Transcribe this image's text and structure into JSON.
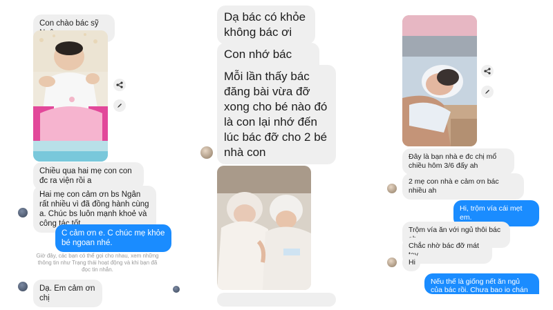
{
  "left": {
    "messages": [
      "Con chào bác sỹ Ngân",
      "Chiều qua hai mẹ con con đc ra viện rồi a",
      "Hai mẹ con cảm ơn bs Ngân rất nhiều vì đã đồng hành cùng a. Chúc bs luôn mạnh khoẻ và công tác tốt",
      "C cảm ơn e. C chúc mẹ khỏe bé ngoan nhé.",
      "Dạ. Em cảm ơn chị"
    ],
    "system_note": "Giờ đây, các bạn có thể gọi cho nhau, xem những thông tin như Trạng thái hoạt động và khi bạn đã đọc tin nhắn."
  },
  "middle": {
    "messages": [
      "Dạ bác có khỏe không bác ơi",
      "Con nhớ bác quá",
      "Mỗi lần thấy bác đăng bài vừa đỡ xong cho bé nào đó là con lại nhớ đến lúc bác đỡ cho 2 bé nhà con"
    ]
  },
  "right": {
    "messages": [
      "Đây là bạn nhà e đc chị mổ chiều hôm 3/6 đấy ah",
      "2 mẹ con nhà e cảm ơn bác nhiều ah",
      "Hi, trộm vía cái mẹt em.",
      "Trộm vía ăn với ngủ thôi bác ah",
      "Chắc nhờ bác đỡ mát tay",
      "Hi",
      "Nếu thế là giống nết ăn ngủ của bác rồi. Chưa bao io chán ăn cả"
    ]
  },
  "icons": [
    "share-icon",
    "edit-icon"
  ],
  "colors": {
    "my_bubble": "#1a8cff",
    "their_bubble": "#efefef",
    "text": "#1c1c1c"
  }
}
